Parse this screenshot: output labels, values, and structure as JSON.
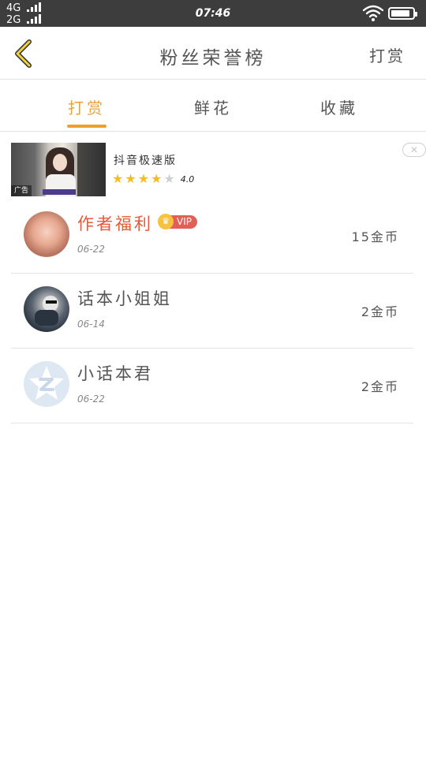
{
  "status_bar": {
    "network_1": "4G",
    "network_2": "2G",
    "time": "07:46",
    "battery_level": 0.9
  },
  "header": {
    "title": "粉丝荣誉榜",
    "action_label": "打赏",
    "back_icon": "chevron-left-icon"
  },
  "tabs": [
    {
      "label": "打赏",
      "active": true
    },
    {
      "label": "鲜花",
      "active": false
    },
    {
      "label": "收藏",
      "active": false
    }
  ],
  "ad": {
    "badge": "广告",
    "app_name": "抖音极速版",
    "rating": "4.0",
    "stars": 4,
    "close_symbol": "✕"
  },
  "fans": [
    {
      "name": "作者福利",
      "date": "06-22",
      "amount": "15金币",
      "vip": true,
      "vip_label": "VIP"
    },
    {
      "name": "话本小姐姐",
      "date": "06-14",
      "amount": "2金币",
      "vip": false
    },
    {
      "name": "小话本君",
      "date": "06-22",
      "amount": "2金币",
      "vip": false
    }
  ],
  "colors": {
    "accent": "#efa02a",
    "vip_name": "#e45a3b",
    "vip_badge": "#e25f58",
    "star": "#f5bb2b",
    "status_bar": "#3d3d3d"
  }
}
